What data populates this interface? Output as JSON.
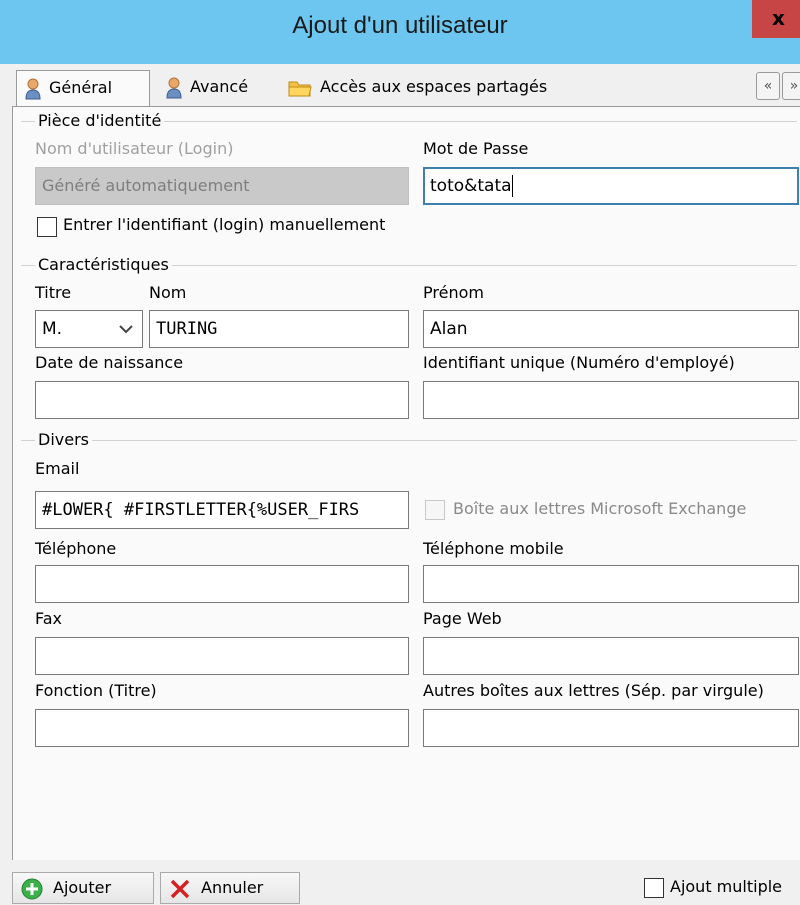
{
  "window": {
    "title": "Ajout d'un utilisateur",
    "close_glyph": "x"
  },
  "tabs": [
    {
      "label": "Général",
      "icon": "user-icon",
      "active": true
    },
    {
      "label": "Avancé",
      "icon": "user-icon",
      "active": false
    },
    {
      "label": "Accès aux espaces partagés",
      "icon": "folder-icon",
      "active": false
    }
  ],
  "tab_nav": {
    "prev_glyph": "«",
    "next_glyph": "»"
  },
  "identity": {
    "group_title": "Pièce d'identité",
    "login_label": "Nom d'utilisateur (Login)",
    "login_value": "Généré automatiquement",
    "password_label": "Mot de Passe",
    "password_value": "toto&tata",
    "manual_login_label": "Entrer l'identifiant (login) manuellement",
    "manual_login_checked": false
  },
  "characteristics": {
    "group_title": "Caractéristiques",
    "title_label": "Titre",
    "title_value": "M.",
    "lastname_label": "Nom",
    "lastname_value": "TURING",
    "firstname_label": "Prénom",
    "firstname_value": "Alan",
    "birthdate_label": "Date de naissance",
    "birthdate_value": "",
    "uid_label": "Identifiant unique (Numéro d'employé)",
    "uid_value": ""
  },
  "misc": {
    "group_title": "Divers",
    "email_label": "Email",
    "email_value": "#LOWER{ #FIRSTLETTER{%USER_FIRS",
    "exchange_label": "Boîte aux lettres Microsoft Exchange",
    "exchange_checked": false,
    "phone_label": "Téléphone",
    "phone_value": "",
    "mobile_label": "Téléphone mobile",
    "mobile_value": "",
    "fax_label": "Fax",
    "fax_value": "",
    "web_label": "Page Web",
    "web_value": "",
    "function_label": "Fonction (Titre)",
    "function_value": "",
    "other_mailboxes_label": "Autres boîtes aux lettres (Sép. par virgule)",
    "other_mailboxes_value": ""
  },
  "footer": {
    "add_label": "Ajouter",
    "cancel_label": "Annuler",
    "multiple_label": "Ajout multiple",
    "multiple_checked": false
  },
  "colors": {
    "titlebar": "#6cc6f0",
    "close_button": "#c74545",
    "focus_border": "#3c7fb1",
    "add_icon": "#3bb04a",
    "cancel_icon": "#d42020"
  }
}
